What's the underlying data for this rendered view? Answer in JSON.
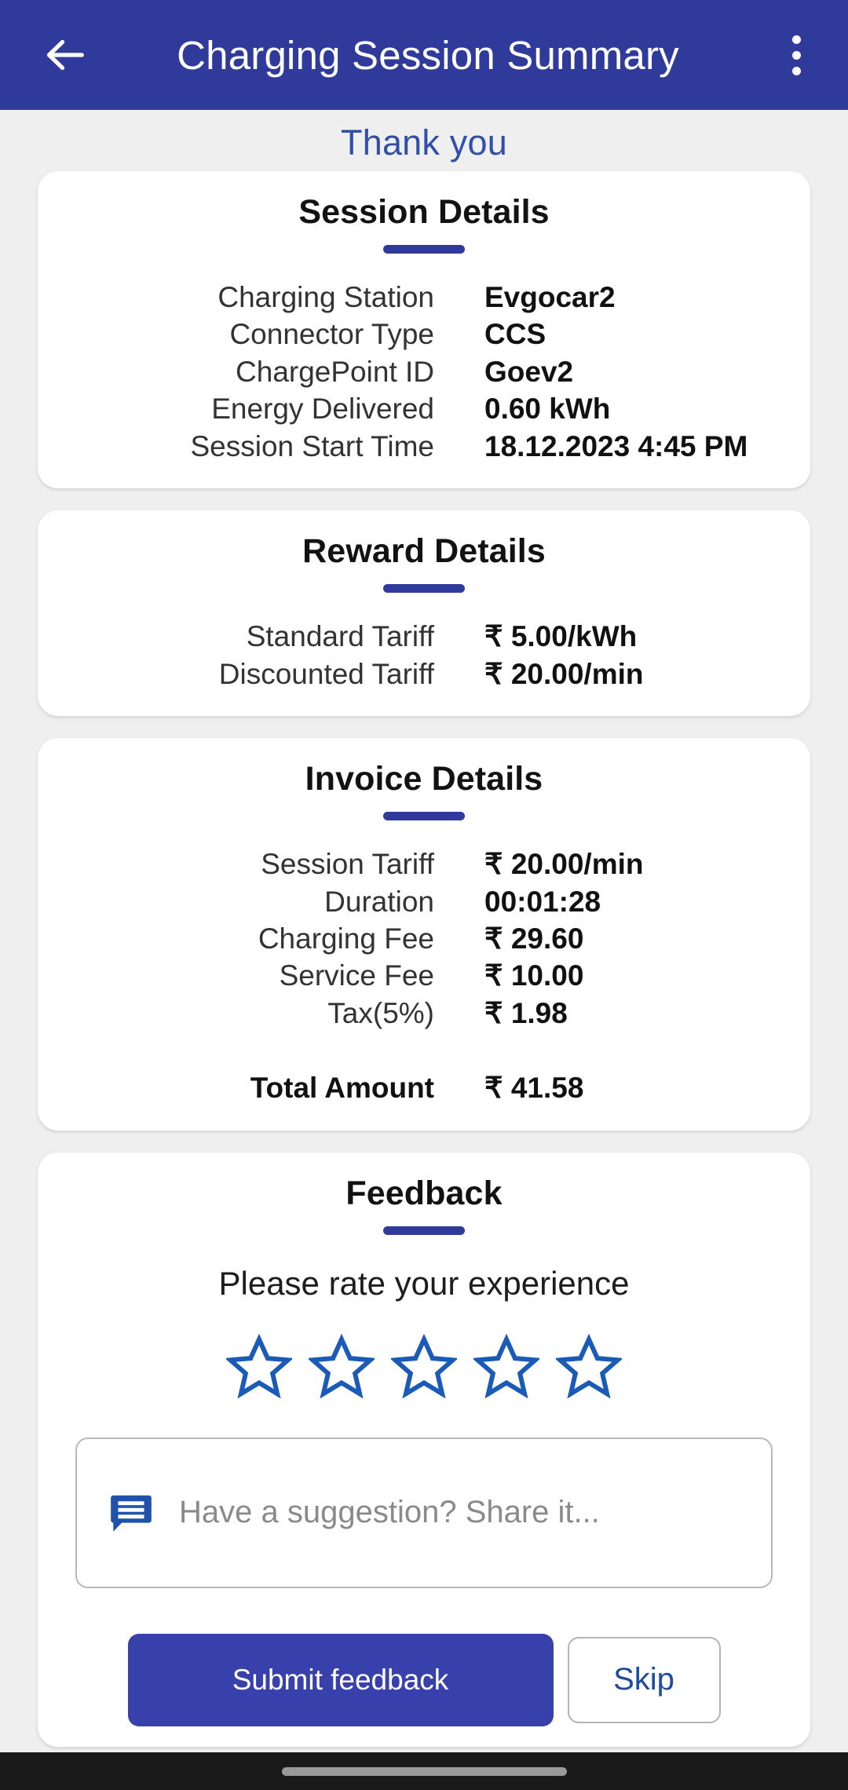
{
  "appbar": {
    "back_icon": "arrow-left-icon",
    "title": "Charging Session Summary",
    "overflow_icon": "more-vertical-icon",
    "background_color": "#2f3a9b"
  },
  "page": {
    "thank_you": "Thank you",
    "background_color": "#efefef",
    "accent_color": "#2f3a9b"
  },
  "session_details": {
    "title": "Session Details",
    "rows": [
      {
        "label": "Charging Station",
        "value": "Evgocar2"
      },
      {
        "label": "Connector Type",
        "value": "CCS"
      },
      {
        "label": "ChargePoint ID",
        "value": "Goev2"
      },
      {
        "label": "Energy Delivered",
        "value": "0.60 kWh"
      },
      {
        "label": "Session Start Time",
        "value": "18.12.2023 4:45 PM"
      }
    ]
  },
  "reward_details": {
    "title": "Reward Details",
    "rows": [
      {
        "label": "Standard Tariff",
        "value": "₹ 5.00/kWh"
      },
      {
        "label": "Discounted Tariff",
        "value": "₹ 20.00/min"
      }
    ]
  },
  "invoice_details": {
    "title": "Invoice Details",
    "rows": [
      {
        "label": "Session Tariff",
        "value": "₹ 20.00/min"
      },
      {
        "label": "Duration",
        "value": "00:01:28"
      },
      {
        "label": "Charging Fee",
        "value": "₹ 29.60"
      },
      {
        "label": "Service Fee",
        "value": "₹ 10.00"
      },
      {
        "label": "Tax(5%)",
        "value": "₹ 1.98"
      }
    ],
    "total": {
      "label": "Total Amount",
      "value": "₹ 41.58"
    }
  },
  "feedback": {
    "title": "Feedback",
    "prompt": "Please rate your experience",
    "rating": 0,
    "max_rating": 5,
    "star_color": "#1a5bb8",
    "star_icon": "star-outline-icon",
    "suggestion": {
      "icon": "message-icon",
      "value": "",
      "placeholder": "Have a suggestion? Share it..."
    },
    "submit_label": "Submit feedback",
    "skip_label": "Skip"
  }
}
